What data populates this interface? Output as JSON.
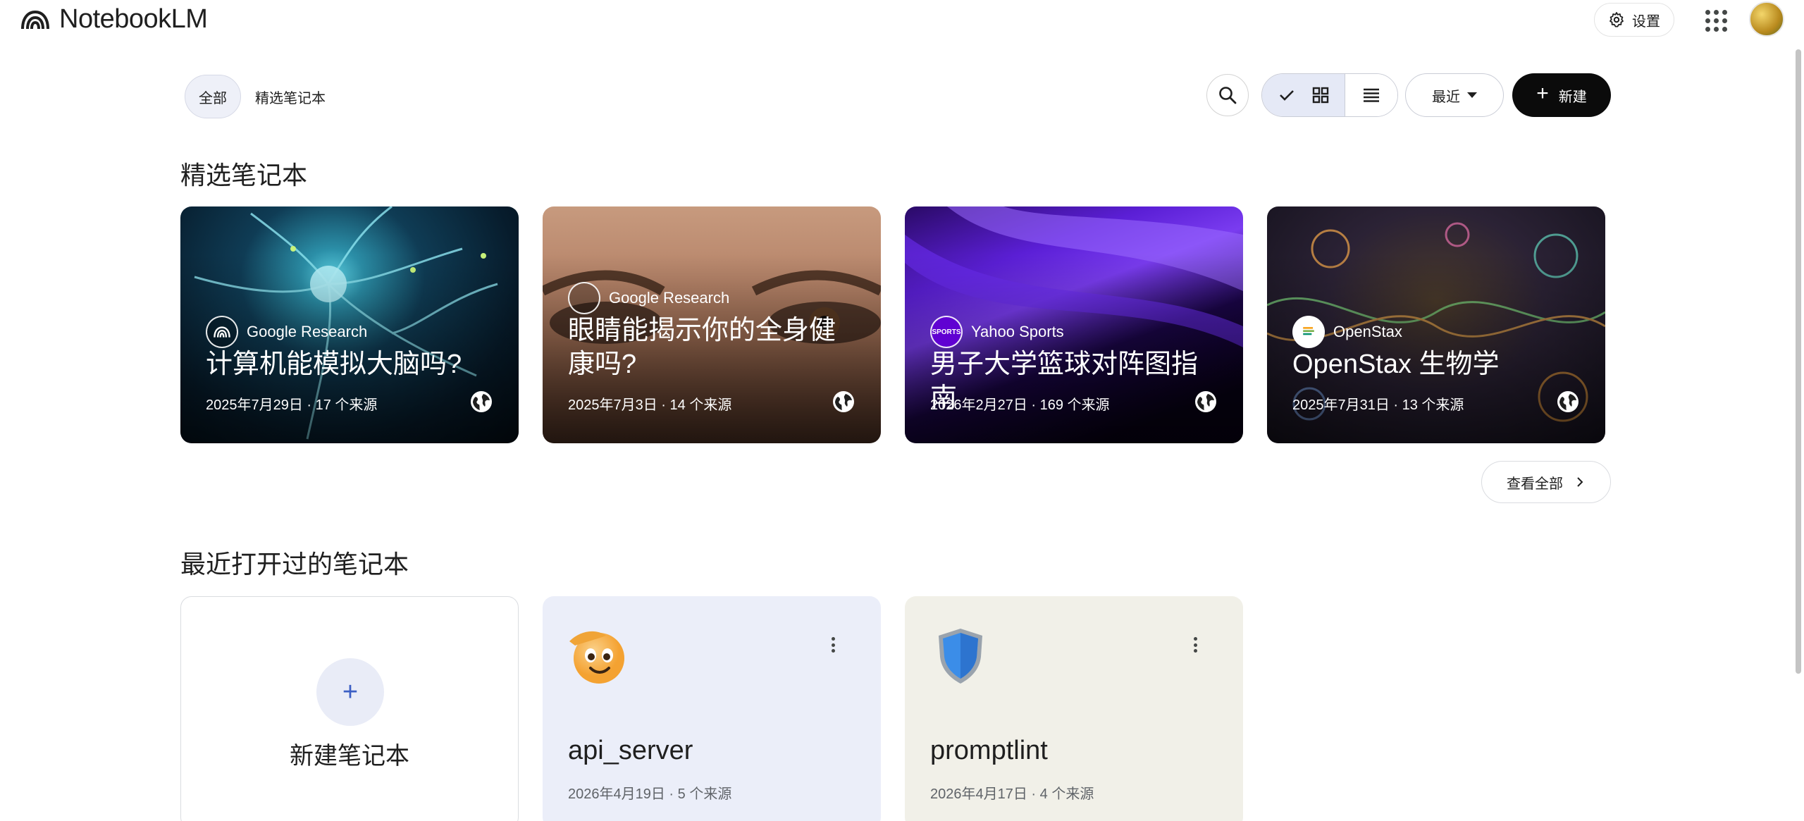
{
  "app": {
    "title": "NotebookLM"
  },
  "header": {
    "settings_label": "设置"
  },
  "filters": {
    "all_label": "全部",
    "featured_label": "精选笔记本"
  },
  "toolbar": {
    "sort_label": "最近",
    "new_label": "新建"
  },
  "featured": {
    "section_title": "精选笔记本",
    "view_all_label": "查看全部",
    "cards": [
      {
        "source": "Google Research",
        "title": "计算机能模拟大脑吗?",
        "meta": "2025年7月29日 · 17 个来源"
      },
      {
        "source": "Google Research",
        "title": "眼睛能揭示你的全身健康吗?",
        "meta": "2025年7月3日 · 14 个来源"
      },
      {
        "source": "Yahoo Sports",
        "source_badge": "SPORTS",
        "title": "男子大学篮球对阵图指南",
        "meta": "2026年2月27日 · 169 个来源"
      },
      {
        "source": "OpenStax",
        "title": "OpenStax 生物学",
        "meta": "2025年7月31日 · 13 个来源"
      }
    ]
  },
  "recent": {
    "section_title": "最近打开过的笔记本",
    "new_notebook_label": "新建笔记本",
    "notebooks": [
      {
        "title": "api_server",
        "meta": "2026年4月19日 · 5 个来源",
        "icon": "saluting-face-emoji"
      },
      {
        "title": "promptlint",
        "meta": "2026年4月17日 · 4 个来源",
        "icon": "blue-shield-emoji"
      }
    ]
  },
  "colors": {
    "accent": "#3c5fc4",
    "primary_button": "#0b0b0b",
    "card_blue": "#ebeef9",
    "card_beige": "#f1f0e8"
  }
}
